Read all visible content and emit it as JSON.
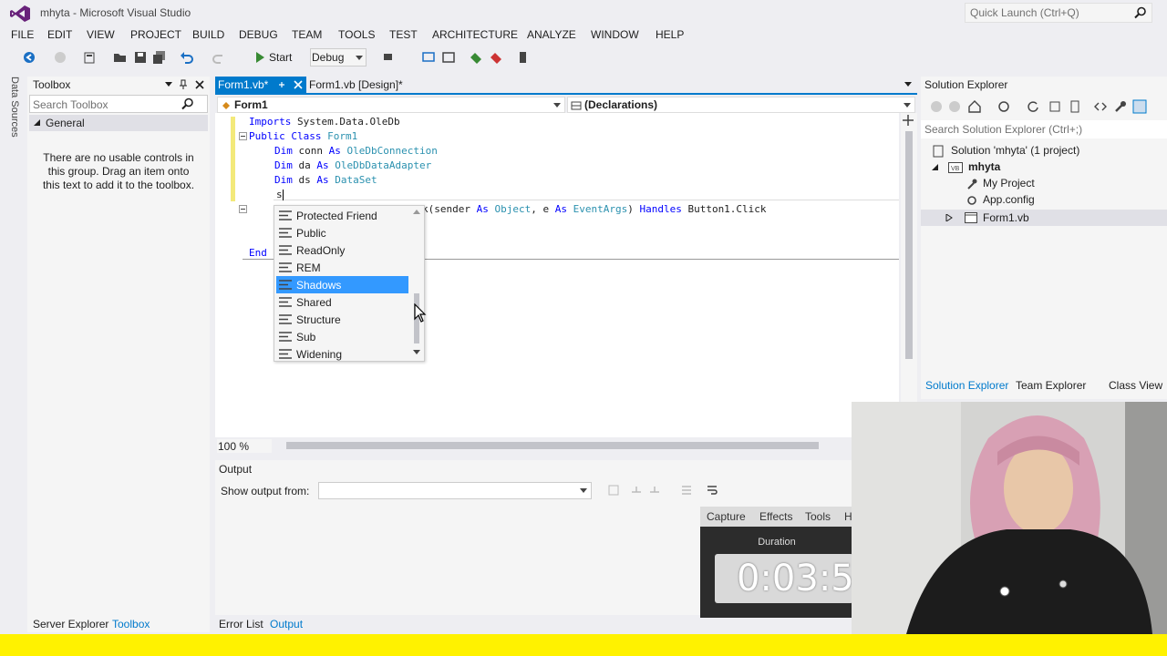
{
  "window": {
    "title": "mhyta - Microsoft Visual Studio",
    "quick_launch_placeholder": "Quick Launch (Ctrl+Q)"
  },
  "menu": [
    "FILE",
    "EDIT",
    "VIEW",
    "PROJECT",
    "BUILD",
    "DEBUG",
    "TEAM",
    "TOOLS",
    "TEST",
    "ARCHITECTURE",
    "ANALYZE",
    "WINDOW",
    "HELP"
  ],
  "toolbar": {
    "start_label": "Start",
    "config_value": "Debug"
  },
  "side_strip": {
    "label": "Data Sources"
  },
  "toolbox": {
    "title": "Toolbox",
    "search_placeholder": "Search Toolbox",
    "group": "General",
    "empty_message": "There are no usable controls in this group. Drag an item onto this text to add it to the toolbox.",
    "bottom_tabs": [
      "Server Explorer",
      "Toolbox"
    ]
  },
  "editor": {
    "tabs": [
      "Form1.vb*",
      "Form1.vb [Design]*"
    ],
    "nav_left": "Form1",
    "nav_right": "(Declarations)",
    "zoom": "100 %",
    "code": {
      "l1_kw": "Imports",
      "l1_rest": " System.Data.OleDb",
      "l2_kw": "Public Class",
      "l2_ty": "Form1",
      "l3_kw": "Dim",
      "l3_a": " conn ",
      "l3_as": "As",
      "l3_ty": "OleDbConnection",
      "l4_kw": "Dim",
      "l4_a": " da ",
      "l4_as": "As",
      "l4_ty": "OleDbDataAdapter",
      "l5_kw": "Dim",
      "l5_a": " ds ",
      "l5_as": "As",
      "l5_ty": "DataSet",
      "l6": "s",
      "l7_a": "k(sender ",
      "l7_as1": "As",
      "l7_ty1": "Object",
      "l7_b": ", e ",
      "l7_as2": "As",
      "l7_ty2": "EventArgs",
      "l7_c": ") ",
      "l7_handles": "Handles",
      "l7_d": " Button1.Click",
      "l8": "End"
    }
  },
  "intellisense": {
    "items": [
      "Protected Friend",
      "Public",
      "ReadOnly",
      "REM",
      "Shadows",
      "Shared",
      "Structure",
      "Sub",
      "Widening"
    ],
    "selected": "Shadows"
  },
  "output": {
    "title": "Output",
    "show_from_label": "Show output from:",
    "bottom_tabs": [
      "Error List",
      "Output"
    ]
  },
  "solution_explorer": {
    "title": "Solution Explorer",
    "search_placeholder": "Search Solution Explorer (Ctrl+;)",
    "tree": [
      "Solution 'mhyta' (1 project)",
      "mhyta",
      "My Project",
      "App.config",
      "Form1.vb"
    ],
    "bottom_tabs": [
      "Solution Explorer",
      "Team Explorer",
      "Class View"
    ]
  },
  "recorder": {
    "tabs": [
      "Capture",
      "Effects",
      "Tools",
      "H"
    ],
    "duration_label": "Duration",
    "time": "0:03:5"
  },
  "colors": {
    "accent": "#007acc",
    "selection": "#3399ff",
    "keyword": "#0000ff",
    "type": "#2b91af",
    "strip": "#fff200"
  }
}
